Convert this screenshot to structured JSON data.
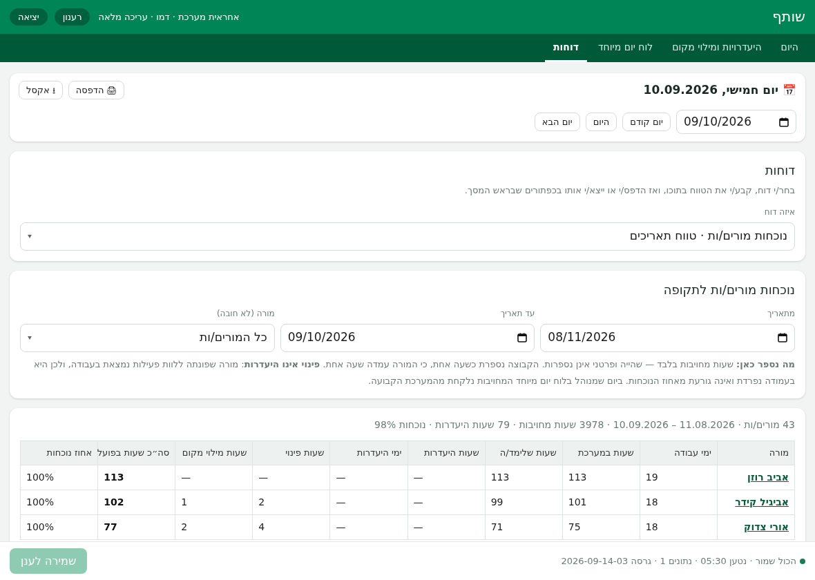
{
  "header": {
    "app_name": "שותף",
    "user_info": "אחראית מערכת · דמו · עריכה מלאה",
    "buttons": [
      "רענון",
      "יציאה"
    ]
  },
  "tabs": [
    {
      "label": "היום",
      "selected": false
    },
    {
      "label": "היעדרויות ומילוי מקום",
      "selected": false
    },
    {
      "label": "לוח יום מיוחד",
      "selected": false
    },
    {
      "label": "דוחות",
      "selected": true
    }
  ],
  "day_card": {
    "icon": "📅",
    "title": "יום חמישי, 10.09.2026",
    "actions": [
      {
        "icon": "🖨",
        "label": "הדפסה"
      },
      {
        "icon": "⭳",
        "label": "אקסל"
      }
    ],
    "date": "09/10/2026",
    "nav": [
      "יום קודם",
      "היום",
      "יום הבא"
    ]
  },
  "reports_card": {
    "title": "דוחות",
    "description": "בחר/י דוח, קבע/י את הטווח בתוכו, ואז הדפס/י או ייצא/י אותו בכפתורים שבראש המסך.",
    "select_label": "איזה דוח",
    "select_value": "נוכחות מורים/ות · טווח תאריכים"
  },
  "period_card": {
    "title": "נוכחות מורים/ות לתקופה",
    "fields": [
      {
        "kind": "date",
        "label": "מתאריך",
        "value": "08/11/2026"
      },
      {
        "kind": "date",
        "label": "עד תאריך",
        "value": "09/10/2026"
      },
      {
        "kind": "select",
        "label": "מורה (לא חובה)",
        "value": "כל המורים/ות"
      }
    ],
    "note": "**מה נספר כאן:** שעות מחויבות בלבד — שהייה ופרטני אינן נספרות. הקבוצה נספרת כשעה אחת, כי המורה עמדה שעה אחת. **פינוי אינו היעדרות**: מורה שפונתה ללוות פעילות נמצאת בעבודה, ולכן היא בעמודה נפרדת ואינה גורעת מאחוז הנוכחות. ביום שמנוהל בלוח יום מיוחד המחויבות נלקחת מהמערכת הקבועה."
  },
  "table_card": {
    "summary": "43 מורים/ות · 11.08.2026 – 10.09.2026 · 3978 שעות מחויבות · 79 שעות היעדרות · נוכחות 98%",
    "columns": [
      "מורה",
      "ימי עבודה",
      "שעות במערכת",
      "שעות שלימד/ה",
      "שעות היעדרות",
      "ימי היעדרות",
      "שעות פינוי",
      "שעות מילוי מקום",
      "סה״כ שעות בפועל",
      "אחוז נוכחות"
    ],
    "rows": [
      [
        "אביב רוזן",
        "19",
        "113",
        "113",
        "—",
        "—",
        "—",
        "—",
        "113",
        "100%"
      ],
      [
        "אביגיל קידר",
        "18",
        "101",
        "99",
        "—",
        "—",
        "2",
        "1",
        "102",
        "100%"
      ],
      [
        "אורי צדוק",
        "18",
        "75",
        "71",
        "—",
        "—",
        "4",
        "2",
        "77",
        "100%"
      ]
    ]
  },
  "footer": {
    "status": {
      "text": "הכול שמור · נטען 05:30 · נתונים 1 · גרסה 2026-09-14-03",
      "color": "#1a7f55"
    },
    "save_button": {
      "label": "שמירה לענן",
      "disabled": true
    }
  }
}
